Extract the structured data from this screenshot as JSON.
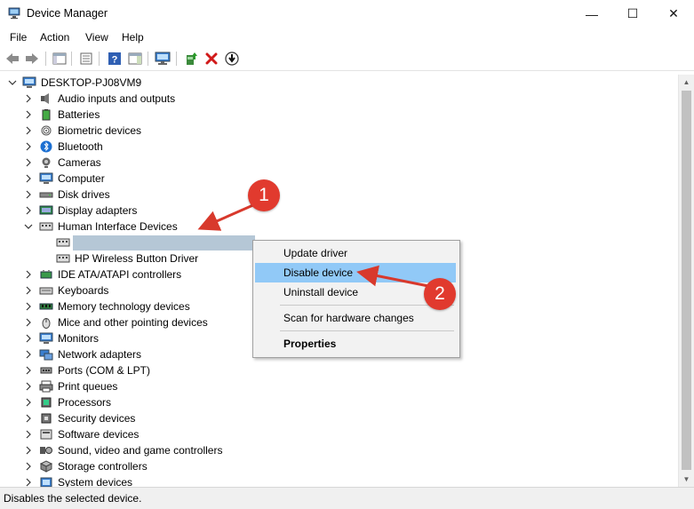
{
  "window": {
    "title": "Device Manager",
    "minimize": "—",
    "maximize": "☐",
    "close": "✕"
  },
  "menu": [
    "File",
    "Action",
    "View",
    "Help"
  ],
  "tree": {
    "root": "DESKTOP-PJ08VM9",
    "categories": [
      {
        "label": "Audio inputs and outputs",
        "icon": "speaker-icon"
      },
      {
        "label": "Batteries",
        "icon": "battery-icon"
      },
      {
        "label": "Biometric devices",
        "icon": "fingerprint-icon"
      },
      {
        "label": "Bluetooth",
        "icon": "bluetooth-icon"
      },
      {
        "label": "Cameras",
        "icon": "camera-icon"
      },
      {
        "label": "Computer",
        "icon": "computer-icon"
      },
      {
        "label": "Disk drives",
        "icon": "disk-icon"
      },
      {
        "label": "Display adapters",
        "icon": "display-icon"
      },
      {
        "label": "Human Interface Devices",
        "icon": "hid-icon",
        "expanded": true
      },
      {
        "label": "IDE ATA/ATAPI controllers",
        "icon": "ide-icon"
      },
      {
        "label": "Keyboards",
        "icon": "keyboard-icon"
      },
      {
        "label": "Memory technology devices",
        "icon": "memory-icon"
      },
      {
        "label": "Mice and other pointing devices",
        "icon": "mouse-icon"
      },
      {
        "label": "Monitors",
        "icon": "monitor-icon"
      },
      {
        "label": "Network adapters",
        "icon": "network-icon"
      },
      {
        "label": "Ports (COM & LPT)",
        "icon": "port-icon"
      },
      {
        "label": "Print queues",
        "icon": "printer-icon"
      },
      {
        "label": "Processors",
        "icon": "processor-icon"
      },
      {
        "label": "Security devices",
        "icon": "security-icon"
      },
      {
        "label": "Software devices",
        "icon": "software-icon"
      },
      {
        "label": "Sound, video and game controllers",
        "icon": "sound-icon"
      },
      {
        "label": "Storage controllers",
        "icon": "storage-icon"
      },
      {
        "label": "System devices",
        "icon": "system-icon"
      }
    ],
    "hid_children": [
      "",
      "HP Wireless Button Driver"
    ]
  },
  "context_menu": {
    "update": "Update driver",
    "disable": "Disable device",
    "uninstall": "Uninstall device",
    "scan": "Scan for hardware changes",
    "properties": "Properties"
  },
  "annotations": {
    "badge1": "1",
    "badge2": "2"
  },
  "status": "Disables the selected device.",
  "colors": {
    "highlight": "#91c9f7",
    "badge": "#e13a2e",
    "arrow": "#d8392c"
  }
}
